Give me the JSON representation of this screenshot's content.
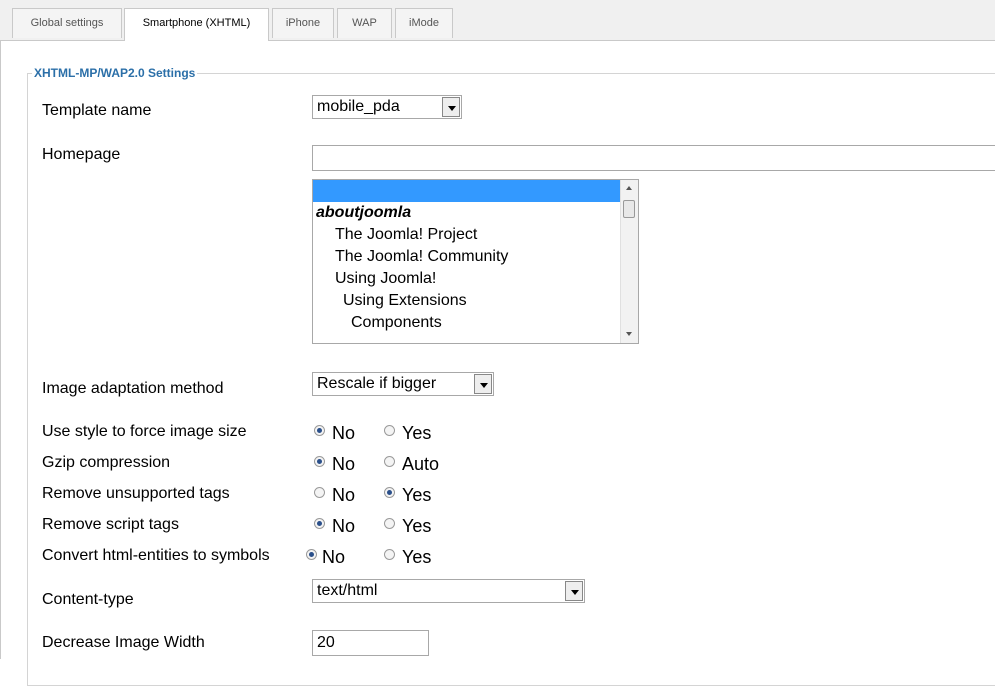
{
  "tabs": [
    {
      "label": "Global settings",
      "active": false
    },
    {
      "label": "Smartphone (XHTML)",
      "active": true
    },
    {
      "label": "iPhone",
      "active": false
    },
    {
      "label": "WAP",
      "active": false
    },
    {
      "label": "iMode",
      "active": false
    }
  ],
  "fieldset_title": "XHTML-MP/WAP2.0 Settings",
  "template": {
    "label": "Template name",
    "value": "mobile_pda"
  },
  "homepage": {
    "label": "Homepage",
    "value": "",
    "options": [
      {
        "label": "",
        "selected": true
      },
      {
        "label": "aboutjoomla",
        "group": true
      },
      {
        "label": "The Joomla! Project",
        "indent": 1
      },
      {
        "label": "The Joomla! Community",
        "indent": 1
      },
      {
        "label": "Using Joomla!",
        "indent": 1
      },
      {
        "label": "Using Extensions",
        "indent": 2
      },
      {
        "label": "Components",
        "indent": 3
      }
    ]
  },
  "image_adaptation": {
    "label": "Image adaptation method",
    "value": "Rescale if bigger"
  },
  "radio_rows": [
    {
      "label": "Use style to force image size",
      "opt1": "No",
      "opt2": "Yes",
      "selected": "No"
    },
    {
      "label": "Gzip compression",
      "opt1": "No",
      "opt2": "Auto",
      "selected": "No"
    },
    {
      "label": "Remove unsupported tags",
      "opt1": "No",
      "opt2": "Yes",
      "selected": "Yes"
    },
    {
      "label": "Remove script tags",
      "opt1": "No",
      "opt2": "Yes",
      "selected": "No"
    },
    {
      "label": "Convert html-entities to symbols",
      "opt1": "No",
      "opt2": "Yes",
      "selected": "No"
    }
  ],
  "content_type": {
    "label": "Content-type",
    "value": "text/html"
  },
  "decrease_width": {
    "label": "Decrease Image Width",
    "value": "20"
  }
}
